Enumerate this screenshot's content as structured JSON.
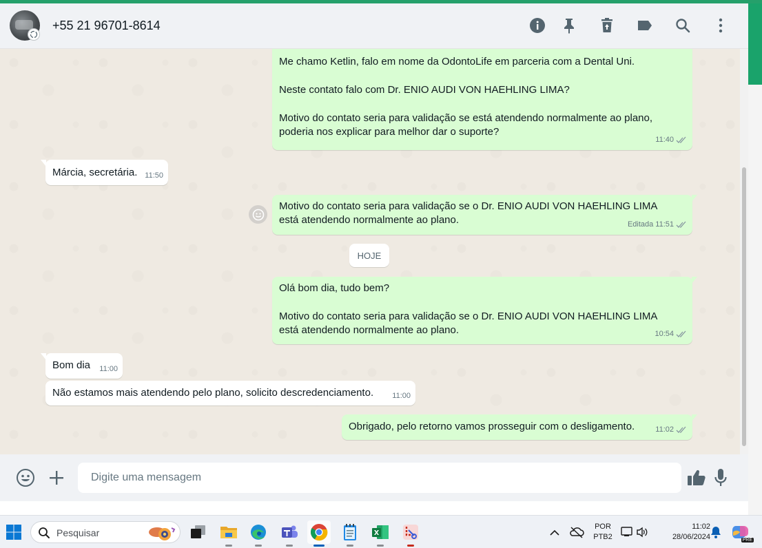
{
  "colors": {
    "accent": "#25a06b",
    "outgoing_bubble": "#d9fdd3",
    "incoming_bubble": "#ffffff",
    "chat_background": "#efeae2",
    "read_ticks": "#667781"
  },
  "header": {
    "contact_name": "+55 21 96701-8614",
    "icons": [
      "info-icon",
      "pin-icon",
      "delete-icon",
      "label-icon",
      "search-icon",
      "menu-icon"
    ]
  },
  "messages": [
    {
      "direction": "outgoing",
      "lines": [
        "Me chamo Ketlin, falo em nome da OdontoLife em parceria com a Dental Uni.",
        "",
        "Neste contato falo com Dr. ENIO AUDI VON HAEHLING LIMA?",
        "",
        "Motivo do contato seria para validação se está atendendo normalmente ao plano,",
        "poderia nos explicar para melhor dar o suporte?"
      ],
      "time": "11:40",
      "status": "read"
    },
    {
      "direction": "incoming",
      "lines": [
        "Márcia, secretária."
      ],
      "time": "11:50"
    },
    {
      "direction": "outgoing",
      "lines": [
        "Motivo do contato seria para validação se o  Dr. ENIO AUDI VON HAEHLING LIMA",
        "está atendendo normalmente ao plano."
      ],
      "edited_label": "Editada",
      "time": "11:51",
      "status": "read"
    },
    {
      "direction": "outgoing",
      "lines": [
        "Olá bom dia, tudo bem?",
        "",
        "Motivo do contato seria para validação se o  Dr. ENIO AUDI VON HAEHLING LIMA",
        "está atendendo normalmente ao plano."
      ],
      "time": "10:54",
      "status": "read"
    },
    {
      "direction": "incoming",
      "lines": [
        "Bom dia"
      ],
      "time": "11:00"
    },
    {
      "direction": "incoming",
      "lines": [
        "Não estamos mais atendendo pelo plano, solicito descredenciamento."
      ],
      "time": "11:00"
    },
    {
      "direction": "outgoing",
      "lines": [
        "Obrigado, pelo retorno vamos prosseguir com o desligamento."
      ],
      "time": "11:02",
      "status": "read"
    }
  ],
  "date_divider": "HOJE",
  "composer": {
    "placeholder": "Digite uma mensagem"
  },
  "taskbar": {
    "search_placeholder": "Pesquisar",
    "language_line1": "POR",
    "language_line2": "PTB2",
    "clock_time": "11:02",
    "clock_date": "28/06/2024",
    "copilot_badge": "PRE"
  }
}
